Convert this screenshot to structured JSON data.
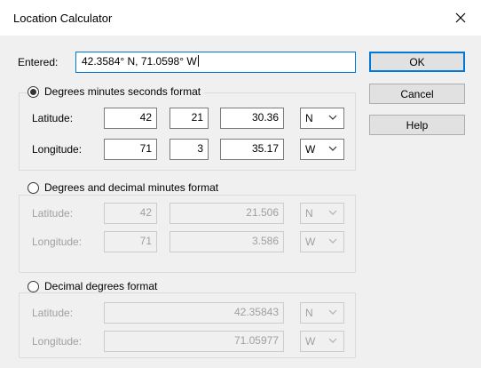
{
  "window": {
    "title": "Location Calculator"
  },
  "entered": {
    "label": "Entered:",
    "value": "42.3584° N, 71.0598° W"
  },
  "buttons": {
    "ok": "OK",
    "cancel": "Cancel",
    "help": "Help"
  },
  "dms": {
    "heading": "Degrees minutes seconds format",
    "selected": true,
    "latitude": {
      "label": "Latitude:",
      "degrees": "42",
      "minutes": "21",
      "seconds": "30.36",
      "hemisphere": "N"
    },
    "longitude": {
      "label": "Longitude:",
      "degrees": "71",
      "minutes": "3",
      "seconds": "35.17",
      "hemisphere": "W"
    }
  },
  "ddm": {
    "heading": "Degrees and decimal minutes format",
    "selected": false,
    "latitude": {
      "label": "Latitude:",
      "degrees": "42",
      "minutes": "21.506",
      "hemisphere": "N"
    },
    "longitude": {
      "label": "Longitude:",
      "degrees": "71",
      "minutes": "3.586",
      "hemisphere": "W"
    }
  },
  "dd": {
    "heading": "Decimal degrees format",
    "selected": false,
    "latitude": {
      "label": "Latitude:",
      "degrees": "42.35843",
      "hemisphere": "N"
    },
    "longitude": {
      "label": "Longitude:",
      "degrees": "71.05977",
      "hemisphere": "W"
    }
  },
  "icons": {
    "close": "close-icon",
    "dropdown": "chevron-down-icon"
  },
  "colors": {
    "focus": "#0078d7",
    "disabled_text": "#a0a0a0"
  }
}
